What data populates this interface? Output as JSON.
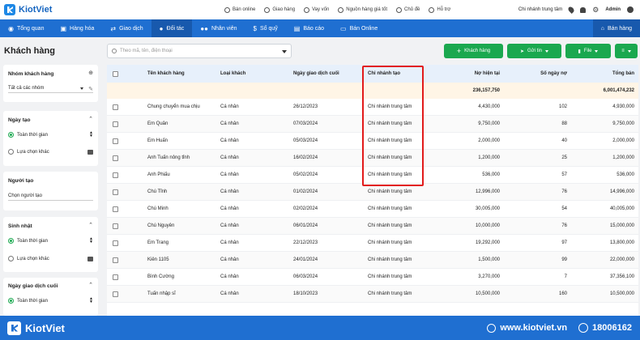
{
  "brand": {
    "name": "KiotViet",
    "accent": "#1f6fd1",
    "green": "#1aa84f",
    "highlight": "#e21b1b"
  },
  "topbar": {
    "links": [
      {
        "icon": "globe-icon",
        "label": "Bán online"
      },
      {
        "icon": "truck-icon",
        "label": "Giao hàng"
      },
      {
        "icon": "wallet-icon",
        "label": "Vay vốn"
      },
      {
        "icon": "bag-icon",
        "label": "Nguồn hàng giá tốt"
      },
      {
        "icon": "palette-icon",
        "label": "Chủ đề"
      },
      {
        "icon": "help-icon",
        "label": "Hỗ trợ"
      }
    ],
    "branch": "Chi nhánh trung tâm",
    "user": "Admin"
  },
  "nav": {
    "items": [
      {
        "icon": "eye-icon",
        "label": "Tổng quan"
      },
      {
        "icon": "box-icon",
        "label": "Hàng hóa"
      },
      {
        "icon": "swap-icon",
        "label": "Giao dịch"
      },
      {
        "icon": "person-icon",
        "label": "Đối tác"
      },
      {
        "icon": "people-icon",
        "label": "Nhân viên"
      },
      {
        "icon": "dollar-icon",
        "label": "Sổ quỹ"
      },
      {
        "icon": "report-icon",
        "label": "Báo cáo"
      },
      {
        "icon": "cart-icon",
        "label": "Bán Online"
      }
    ],
    "active": "Đối tác",
    "sell": "Bán hàng"
  },
  "page": {
    "title": "Khách hàng",
    "search_placeholder": "Theo mã, tên, điện thoại",
    "buttons": {
      "add": "Khách hàng",
      "send": "Gửi tin",
      "file": "File"
    }
  },
  "filters": {
    "group": {
      "title": "Nhóm khách hàng",
      "value": "Tất cả các nhóm"
    },
    "created": {
      "title": "Ngày tạo",
      "opt1": "Toàn thời gian",
      "opt2": "Lựa chọn khác"
    },
    "creator": {
      "title": "Người tạo",
      "value": "Chọn người tạo"
    },
    "birthday": {
      "title": "Sinh nhật",
      "opt1": "Toàn thời gian",
      "opt2": "Lựa chọn khác"
    },
    "last_tx": {
      "title": "Ngày giao dịch cuối",
      "opt1": "Toàn thời gian"
    }
  },
  "table": {
    "columns": [
      "Tên khách hàng",
      "Loại khách",
      "Ngày giao dịch cuối",
      "Chi nhánh tạo",
      "Nợ hiện tại",
      "Số ngày nợ",
      "Tổng bán"
    ],
    "summary": {
      "debt": "236,157,750",
      "total": "6,001,474,232"
    },
    "rows": [
      [
        "Chung chuyển mua chịu",
        "Cá nhân",
        "26/12/2023",
        "Chi nhánh trung tâm",
        "4,430,000",
        "102",
        "4,930,000"
      ],
      [
        "Em Quân",
        "Cá nhân",
        "07/03/2024",
        "Chi nhánh trung tâm",
        "9,750,000",
        "88",
        "9,750,000"
      ],
      [
        "Em Huấn",
        "Cá nhân",
        "05/03/2024",
        "Chi nhánh trung tâm",
        "2,000,000",
        "40",
        "2,000,000"
      ],
      [
        "Anh Tuấn nông tỉnh",
        "Cá nhân",
        "16/02/2024",
        "Chi nhánh trung tâm",
        "1,200,000",
        "25",
        "1,200,000"
      ],
      [
        "Anh Phiấu",
        "Cá nhân",
        "05/02/2024",
        "Chi nhánh trung tâm",
        "536,000",
        "57",
        "536,000"
      ],
      [
        "Chú Tỉnh",
        "Cá nhân",
        "01/02/2024",
        "Chi nhánh trung tâm",
        "12,996,000",
        "76",
        "14,996,000"
      ],
      [
        "Chú Minh",
        "Cá nhân",
        "02/02/2024",
        "Chi nhánh trung tâm",
        "30,005,000",
        "54",
        "40,005,000"
      ],
      [
        "Chú Nguyên",
        "Cá nhân",
        "06/01/2024",
        "Chi nhánh trung tâm",
        "10,000,000",
        "76",
        "15,000,000"
      ],
      [
        "Em Trang",
        "Cá nhân",
        "22/12/2023",
        "Chi nhánh trung tâm",
        "19,292,000",
        "97",
        "13,800,000"
      ],
      [
        "Kiên 1105",
        "Cá nhân",
        "24/01/2024",
        "Chi nhánh trung tâm",
        "1,500,000",
        "99",
        "22,000,000"
      ],
      [
        "Bình Cường",
        "Cá nhân",
        "06/03/2024",
        "Chi nhánh trung tâm",
        "3,270,000",
        "7",
        "37,356,100"
      ],
      [
        "Tuấn nhập sĩ",
        "Cá nhân",
        "18/10/2023",
        "Chi nhánh trung tâm",
        "10,500,000",
        "160",
        "10,500,000"
      ]
    ]
  },
  "footer": {
    "brand": "KiotViet",
    "site": "www.kiotviet.vn",
    "phone": "18006162"
  }
}
